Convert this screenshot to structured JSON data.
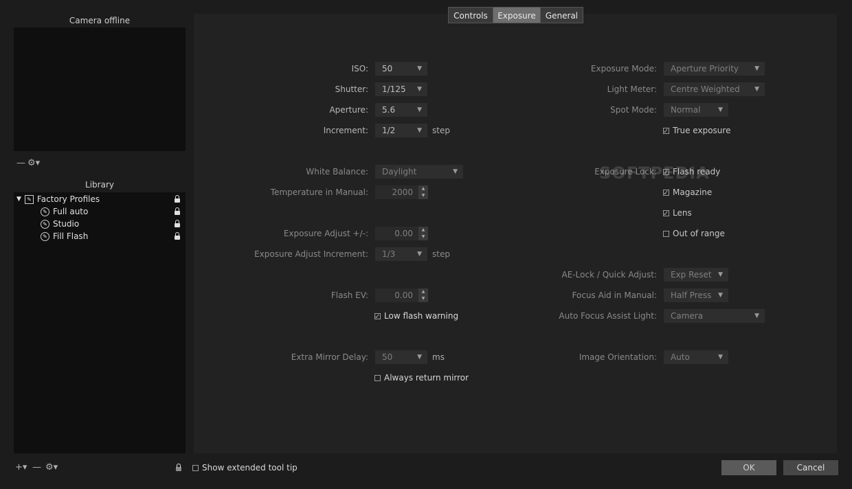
{
  "camera": {
    "title": "Camera offline"
  },
  "library": {
    "title": "Library",
    "tree": [
      {
        "label": "Factory Profiles"
      },
      {
        "label": "Full auto"
      },
      {
        "label": "Studio"
      },
      {
        "label": "Fill Flash"
      }
    ]
  },
  "tabs": [
    {
      "label": "Controls"
    },
    {
      "label": "Exposure"
    },
    {
      "label": "General"
    }
  ],
  "active_tab": "Exposure",
  "left_fields": {
    "iso": {
      "label": "ISO:",
      "value": "50"
    },
    "shutter": {
      "label": "Shutter:",
      "value": "1/125"
    },
    "aperture": {
      "label": "Aperture:",
      "value": "5.6"
    },
    "increment": {
      "label": "Increment:",
      "value": "1/2",
      "unit": "step"
    },
    "white_balance": {
      "label": "White Balance:",
      "value": "Daylight"
    },
    "temperature": {
      "label": "Temperature in Manual:",
      "value": "2000"
    },
    "exposure_adjust": {
      "label": "Exposure Adjust +/-:",
      "value": "0.00"
    },
    "exposure_adjust_increment": {
      "label": "Exposure Adjust Increment:",
      "value": "1/3",
      "unit": "step"
    },
    "flash_ev": {
      "label": "Flash EV:",
      "value": "0.00"
    },
    "low_flash_warning": {
      "label": "Low flash warning",
      "checked": true
    },
    "extra_mirror_delay": {
      "label": "Extra Mirror Delay:",
      "value": "50",
      "unit": "ms"
    },
    "always_return_mirror": {
      "label": "Always return mirror",
      "checked": false
    }
  },
  "right_fields": {
    "exposure_mode": {
      "label": "Exposure Mode:",
      "value": "Aperture Priority"
    },
    "light_meter": {
      "label": "Light Meter:",
      "value": "Centre Weighted"
    },
    "spot_mode": {
      "label": "Spot Mode:",
      "value": "Normal"
    },
    "true_exposure": {
      "label": "True exposure",
      "checked": true
    },
    "exposure_lock": {
      "label": "Exposure Lock:"
    },
    "flash_ready": {
      "label": "Flash ready",
      "checked": true
    },
    "magazine": {
      "label": "Magazine",
      "checked": true
    },
    "lens": {
      "label": "Lens",
      "checked": true
    },
    "out_of_range": {
      "label": "Out of range",
      "checked": false
    },
    "ae_lock": {
      "label": "AE-Lock / Quick Adjust:",
      "value": "Exp Reset"
    },
    "focus_aid": {
      "label": "Focus Aid in Manual:",
      "value": "Half Press"
    },
    "af_assist": {
      "label": "Auto Focus Assist Light:",
      "value": "Camera"
    },
    "image_orientation": {
      "label": "Image Orientation:",
      "value": "Auto"
    }
  },
  "footer": {
    "show_tooltip": {
      "label": "Show extended tool tip",
      "checked": false
    },
    "ok": "OK",
    "cancel": "Cancel"
  },
  "watermark": "SOFTPEDIA"
}
